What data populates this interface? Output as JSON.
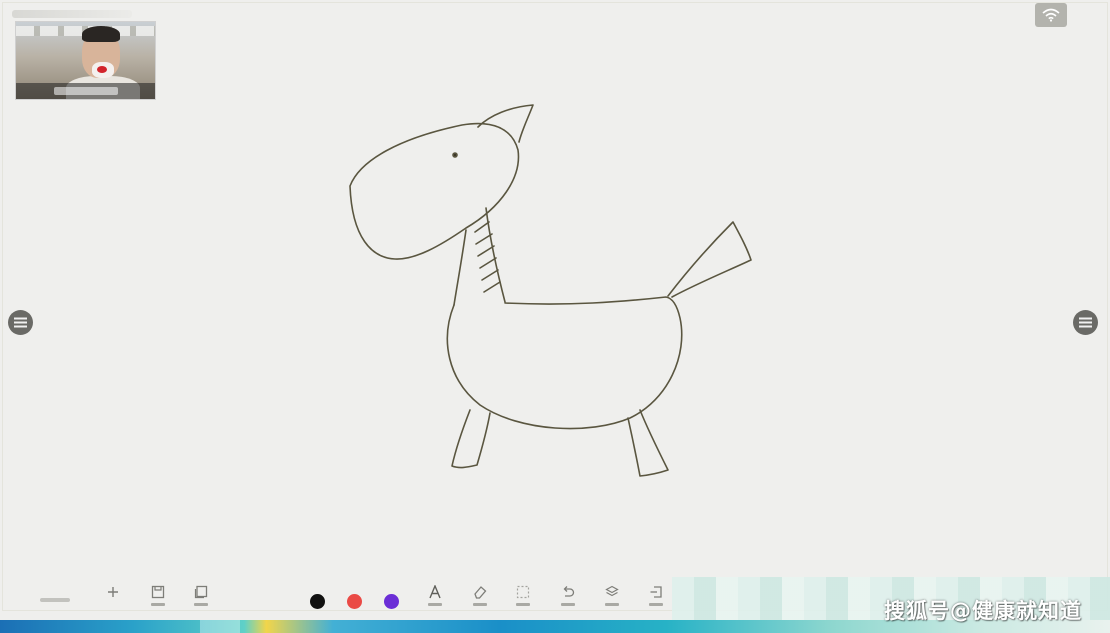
{
  "watermark": {
    "text": "搜狐号@健康就知道"
  },
  "toolbar": {
    "tools": [
      {
        "icon": "plus-icon"
      },
      {
        "icon": "save-icon"
      },
      {
        "icon": "page-icon"
      },
      {
        "icon": "text-icon"
      },
      {
        "icon": "eraser-icon"
      },
      {
        "icon": "select-icon"
      },
      {
        "icon": "undo-icon"
      },
      {
        "icon": "clear-icon"
      },
      {
        "icon": "exit-icon"
      }
    ],
    "pen_colors": [
      "#111111",
      "#ea4a45",
      "#6b2ed6"
    ]
  },
  "colors": {
    "canvas": "#efefed",
    "stroke": "#5a5640",
    "side_button": "#6a6a66"
  }
}
